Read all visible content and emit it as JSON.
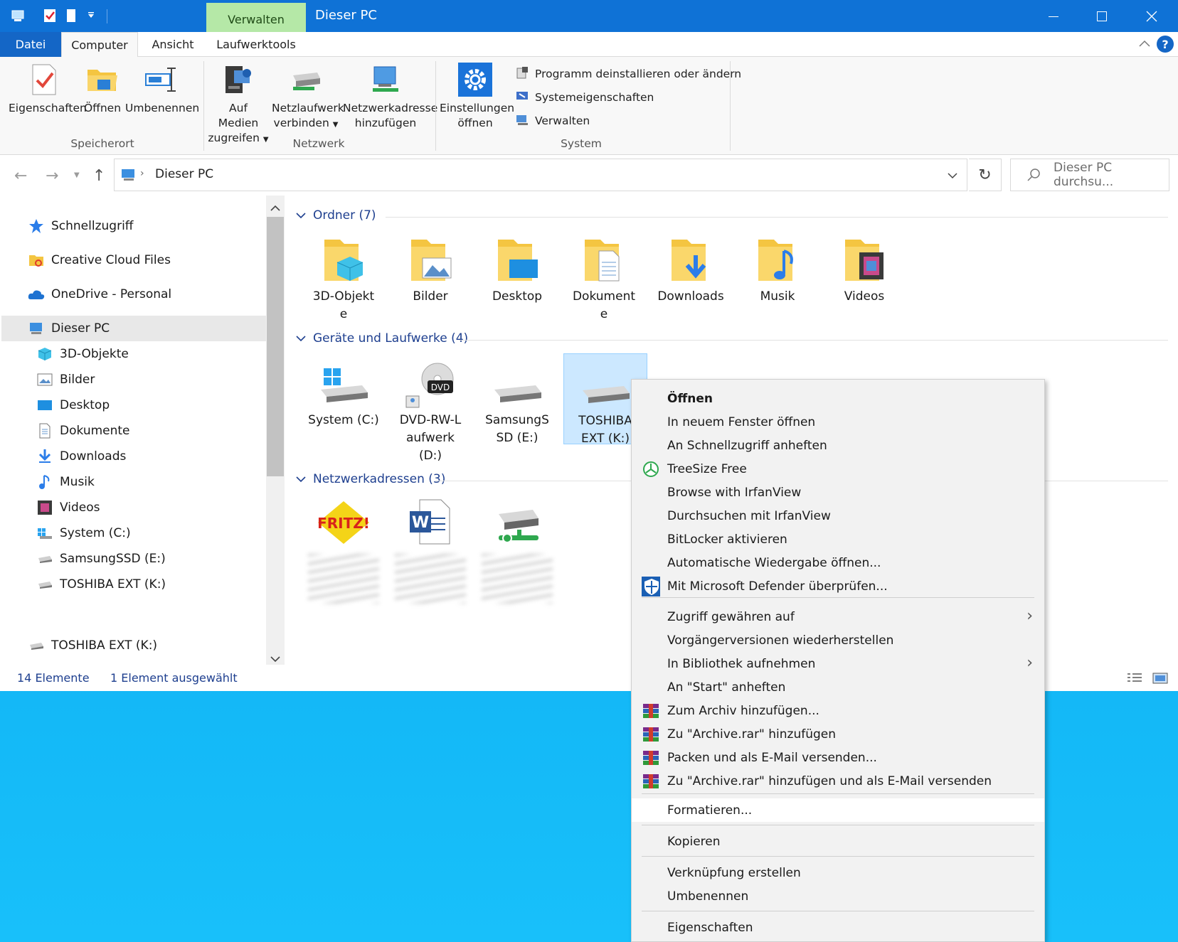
{
  "window": {
    "title": "Dieser PC",
    "context_tab": "Verwalten"
  },
  "ribbon_tabs": [
    "Datei",
    "Computer",
    "Ansicht",
    "Laufwerktools"
  ],
  "ribbon": {
    "speicherort": {
      "label": "Speicherort",
      "eigenschaften": "Eigenschaften",
      "oeffnen": "Öffnen",
      "umbenennen": "Umbenennen"
    },
    "netzwerk": {
      "label": "Netzwerk",
      "medien_1": "Auf Medien",
      "medien_2": "zugreifen",
      "laufwerk_1": "Netzlaufwerk",
      "laufwerk_2": "verbinden",
      "adresse_1": "Netzwerkadresse",
      "adresse_2": "hinzufügen"
    },
    "system": {
      "label": "System",
      "einstellungen_1": "Einstellungen",
      "einstellungen_2": "öffnen",
      "programm": "Programm deinstallieren oder ändern",
      "systemeigenschaften": "Systemeigenschaften",
      "verwalten": "Verwalten"
    }
  },
  "address": {
    "path": "Dieser PC",
    "search_placeholder": "Dieser PC durchsu..."
  },
  "nav": {
    "top": [
      "Schnellzugriff",
      "Creative Cloud Files",
      "OneDrive - Personal",
      "Dieser PC"
    ],
    "children": [
      "3D-Objekte",
      "Bilder",
      "Desktop",
      "Dokumente",
      "Downloads",
      "Musik",
      "Videos",
      "System (C:)",
      "SamsungSSD (E:)",
      "TOSHIBA EXT (K:)"
    ],
    "bottom": "TOSHIBA EXT (K:)"
  },
  "content": {
    "folders_header": "Ordner (7)",
    "folders": [
      {
        "l1": "3D-Objekt",
        "l2": "e"
      },
      {
        "l1": "Bilder",
        "l2": ""
      },
      {
        "l1": "Desktop",
        "l2": ""
      },
      {
        "l1": "Dokument",
        "l2": "e"
      },
      {
        "l1": "Downloads",
        "l2": ""
      },
      {
        "l1": "Musik",
        "l2": ""
      },
      {
        "l1": "Videos",
        "l2": ""
      }
    ],
    "drives_header": "Geräte und Laufwerke (4)",
    "drives": [
      {
        "l1": "System (C:)",
        "l2": "",
        "l3": ""
      },
      {
        "l1": "DVD-RW-L",
        "l2": "aufwerk",
        "l3": "(D:)"
      },
      {
        "l1": "SamsungS",
        "l2": "SD (E:)",
        "l3": ""
      },
      {
        "l1": "TOSHIBA",
        "l2": "EXT (K:)",
        "l3": ""
      }
    ],
    "dvd_badge": "DVD",
    "network_header": "Netzwerkadressen (3)",
    "fritz_logo": "FRITZ!"
  },
  "status": {
    "count": "14 Elemente",
    "selected": "1 Element ausgewählt"
  },
  "context_menu": {
    "items": [
      "Öffnen",
      "In neuem Fenster öffnen",
      "An Schnellzugriff anheften",
      "TreeSize Free",
      "Browse with IrfanView",
      "Durchsuchen mit IrfanView",
      "BitLocker aktivieren",
      "Automatische Wiedergabe öffnen...",
      "Mit Microsoft Defender überprüfen...",
      "Zugriff gewähren auf",
      "Vorgängerversionen wiederherstellen",
      "In Bibliothek aufnehmen",
      "An \"Start\" anheften",
      "Zum Archiv hinzufügen...",
      "Zu \"Archive.rar\" hinzufügen",
      "Packen und als E-Mail versenden...",
      "Zu \"Archive.rar\" hinzufügen und als E-Mail versenden",
      "Formatieren...",
      "Kopieren",
      "Verknüpfung erstellen",
      "Umbenennen",
      "Eigenschaften"
    ]
  },
  "colors": {
    "titlebar": "#0f72d6",
    "accent": "#1466c6",
    "context_tab": "#b5e8a7",
    "selection": "#cce8ff",
    "desktop": "#0aa9f0"
  }
}
